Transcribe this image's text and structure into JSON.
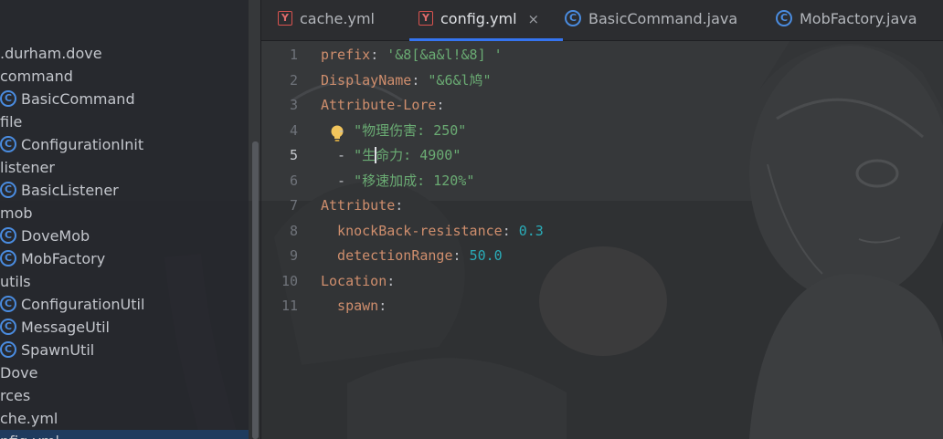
{
  "tree": {
    "items": [
      {
        "label": ".durham.dove",
        "icon": "package-icon"
      },
      {
        "label": "command",
        "icon": "package-icon"
      },
      {
        "label": "BasicCommand",
        "icon": "class-icon"
      },
      {
        "label": "file",
        "icon": "package-icon"
      },
      {
        "label": "ConfigurationInit",
        "icon": "class-icon"
      },
      {
        "label": "listener",
        "icon": "package-icon"
      },
      {
        "label": "BasicListener",
        "icon": "class-icon"
      },
      {
        "label": "mob",
        "icon": "package-icon"
      },
      {
        "label": "DoveMob",
        "icon": "class-icon"
      },
      {
        "label": "MobFactory",
        "icon": "class-icon"
      },
      {
        "label": "utils",
        "icon": "package-icon"
      },
      {
        "label": "ConfigurationUtil",
        "icon": "class-icon"
      },
      {
        "label": "MessageUtil",
        "icon": "class-icon"
      },
      {
        "label": "SpawnUtil",
        "icon": "class-icon"
      },
      {
        "label": "Dove",
        "icon": "class-icon"
      },
      {
        "label": "rces",
        "icon": "folder-icon"
      },
      {
        "label": "che.yml",
        "icon": "yaml-file-icon"
      },
      {
        "label": "nfig.yml",
        "icon": "yaml-file-icon"
      }
    ],
    "class_glyph": "C"
  },
  "tabs": [
    {
      "label": "cache.yml",
      "icon": "yaml-icon"
    },
    {
      "label": "config.yml",
      "icon": "yaml-icon",
      "active": true
    },
    {
      "label": "BasicCommand.java",
      "icon": "java-class-icon"
    },
    {
      "label": "MobFactory.java",
      "icon": "java-class-icon"
    }
  ],
  "tab_glyphs": {
    "yaml": "Y",
    "java": "C",
    "close": "×"
  },
  "editor": {
    "current_line": 5,
    "lines": [
      {
        "n": "1",
        "tokens": [
          {
            "t": "prefix",
            "c": "key"
          },
          {
            "t": ": ",
            "c": "punct"
          },
          {
            "t": "'&8[&a&l!&8] '",
            "c": "str"
          }
        ]
      },
      {
        "n": "2",
        "tokens": [
          {
            "t": "DisplayName",
            "c": "key"
          },
          {
            "t": ": ",
            "c": "punct"
          },
          {
            "t": "\"&6&l鸠\"",
            "c": "str"
          }
        ]
      },
      {
        "n": "3",
        "tokens": [
          {
            "t": "Attribute-Lore",
            "c": "key"
          },
          {
            "t": ":",
            "c": "punct"
          }
        ]
      },
      {
        "n": "4",
        "tokens": [
          {
            "t": "  - ",
            "c": "dash"
          },
          {
            "t": "\"物理伤害: 250\"",
            "c": "str"
          }
        ]
      },
      {
        "n": "5",
        "tokens": [
          {
            "t": "  - ",
            "c": "dash"
          },
          {
            "t": "\"生",
            "c": "str"
          },
          {
            "t": "|caret|",
            "c": "caret"
          },
          {
            "t": "命力: 4900\"",
            "c": "str"
          }
        ]
      },
      {
        "n": "6",
        "tokens": [
          {
            "t": "  - ",
            "c": "dash"
          },
          {
            "t": "\"移速加成: 120%\"",
            "c": "str"
          }
        ]
      },
      {
        "n": "7",
        "tokens": [
          {
            "t": "Attribute",
            "c": "key"
          },
          {
            "t": ":",
            "c": "punct"
          }
        ]
      },
      {
        "n": "8",
        "tokens": [
          {
            "t": "  knockBack-resistance",
            "c": "key"
          },
          {
            "t": ": ",
            "c": "punct"
          },
          {
            "t": "0.3",
            "c": "num"
          }
        ]
      },
      {
        "n": "9",
        "tokens": [
          {
            "t": "  detectionRange",
            "c": "key"
          },
          {
            "t": ": ",
            "c": "punct"
          },
          {
            "t": "50.0",
            "c": "num"
          }
        ]
      },
      {
        "n": "10",
        "tokens": [
          {
            "t": "Location",
            "c": "key"
          },
          {
            "t": ":",
            "c": "punct"
          }
        ]
      },
      {
        "n": "11",
        "tokens": [
          {
            "t": "  spawn",
            "c": "key"
          },
          {
            "t": ":",
            "c": "punct"
          }
        ]
      }
    ]
  },
  "colors": {
    "accent": "#3574f0",
    "key": "#cf8e6d",
    "string": "#6aab73",
    "number": "#2aacb8",
    "class_icon": "#4a8ce0",
    "yaml_icon": "#e06c6c"
  }
}
